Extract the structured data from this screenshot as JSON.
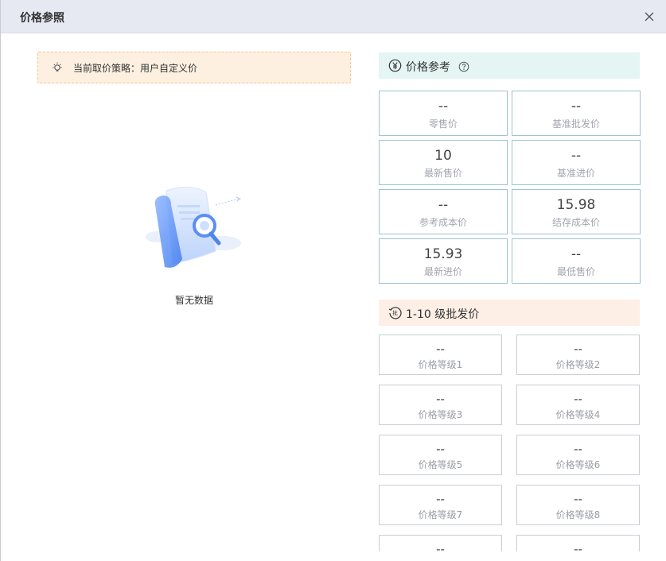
{
  "dialog": {
    "title": "价格参照"
  },
  "strategy": {
    "text": "当前取价策略：用户自定义价"
  },
  "empty": {
    "text": "暂无数据"
  },
  "price_ref": {
    "title": "价格参考",
    "cells": [
      {
        "value": "--",
        "label": "零售价"
      },
      {
        "value": "--",
        "label": "基准批发价"
      },
      {
        "value": "10",
        "label": "最新售价"
      },
      {
        "value": "--",
        "label": "基准进价"
      },
      {
        "value": "--",
        "label": "参考成本价"
      },
      {
        "value": "15.98",
        "label": "结存成本价"
      },
      {
        "value": "15.93",
        "label": "最新进价"
      },
      {
        "value": "--",
        "label": "最低售价"
      }
    ]
  },
  "wholesale": {
    "title": "1-10 级批发价",
    "levels": [
      {
        "value": "--",
        "label": "价格等级1"
      },
      {
        "value": "--",
        "label": "价格等级2"
      },
      {
        "value": "--",
        "label": "价格等级3"
      },
      {
        "value": "--",
        "label": "价格等级4"
      },
      {
        "value": "--",
        "label": "价格等级5"
      },
      {
        "value": "--",
        "label": "价格等级6"
      },
      {
        "value": "--",
        "label": "价格等级7"
      },
      {
        "value": "--",
        "label": "价格等级8"
      },
      {
        "value": "--",
        "label": ""
      },
      {
        "value": "--",
        "label": ""
      }
    ]
  },
  "colors": {
    "header_bg": "#e6e9f2",
    "green_head": "#e4f5f3",
    "orange_head": "#fdefe6",
    "strategy_bg": "#fdf0e0"
  }
}
